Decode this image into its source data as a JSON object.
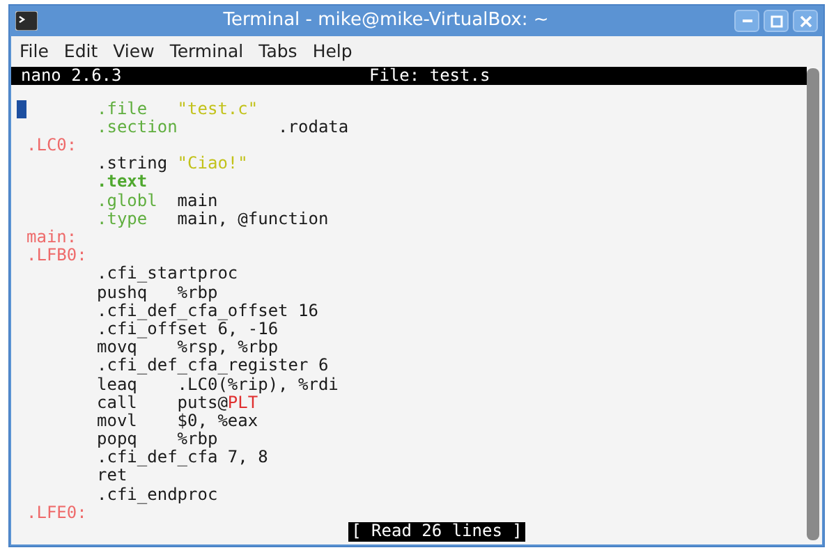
{
  "window": {
    "title": "Terminal - mike@mike-VirtualBox: ~"
  },
  "menu": [
    "File",
    "Edit",
    "View",
    "Terminal",
    "Tabs",
    "Help"
  ],
  "nano_header": {
    "version": "nano 2.6.3",
    "file": "File: test.s"
  },
  "lines": [
    {
      "cursor": true,
      "kind": "code",
      "segments": [
        {
          "kind": "directive",
          "text": ".file   "
        },
        {
          "kind": "string",
          "text": "\"test.c\""
        }
      ]
    },
    {
      "cursor": false,
      "kind": "code",
      "segments": [
        {
          "kind": "directive",
          "text": ".section"
        },
        {
          "kind": "plain",
          "text": "          .rodata"
        }
      ]
    },
    {
      "cursor": false,
      "kind": "label",
      "segments": [
        {
          "kind": "label",
          "text": ".LC0:"
        }
      ]
    },
    {
      "cursor": false,
      "kind": "code",
      "segments": [
        {
          "kind": "plain",
          "text": ".string "
        },
        {
          "kind": "string",
          "text": "\"Ciao!\""
        }
      ]
    },
    {
      "cursor": false,
      "kind": "code",
      "segments": [
        {
          "kind": "keyword",
          "text": ".text"
        }
      ]
    },
    {
      "cursor": false,
      "kind": "code",
      "segments": [
        {
          "kind": "directive",
          "text": ".globl"
        },
        {
          "kind": "plain",
          "text": "  main"
        }
      ]
    },
    {
      "cursor": false,
      "kind": "code",
      "segments": [
        {
          "kind": "directive",
          "text": ".type"
        },
        {
          "kind": "plain",
          "text": "   main, @function"
        }
      ]
    },
    {
      "cursor": false,
      "kind": "label",
      "segments": [
        {
          "kind": "label",
          "text": "main:"
        }
      ]
    },
    {
      "cursor": false,
      "kind": "label",
      "segments": [
        {
          "kind": "label",
          "text": ".LFB0:"
        }
      ]
    },
    {
      "cursor": false,
      "kind": "code",
      "segments": [
        {
          "kind": "plain",
          "text": ".cfi_startproc"
        }
      ]
    },
    {
      "cursor": false,
      "kind": "code",
      "segments": [
        {
          "kind": "plain",
          "text": "pushq   %rbp"
        }
      ]
    },
    {
      "cursor": false,
      "kind": "code",
      "segments": [
        {
          "kind": "plain",
          "text": ".cfi_def_cfa_offset 16"
        }
      ]
    },
    {
      "cursor": false,
      "kind": "code",
      "segments": [
        {
          "kind": "plain",
          "text": ".cfi_offset 6, -16"
        }
      ]
    },
    {
      "cursor": false,
      "kind": "code",
      "segments": [
        {
          "kind": "plain",
          "text": "movq    %rsp, %rbp"
        }
      ]
    },
    {
      "cursor": false,
      "kind": "code",
      "segments": [
        {
          "kind": "plain",
          "text": ".cfi_def_cfa_register 6"
        }
      ]
    },
    {
      "cursor": false,
      "kind": "code",
      "segments": [
        {
          "kind": "plain",
          "text": "leaq    .LC0(%rip), %rdi"
        }
      ]
    },
    {
      "cursor": false,
      "kind": "code",
      "segments": [
        {
          "kind": "plain",
          "text": "call    puts@"
        },
        {
          "kind": "error",
          "text": "PLT"
        }
      ]
    },
    {
      "cursor": false,
      "kind": "code",
      "segments": [
        {
          "kind": "plain",
          "text": "movl    $0, %eax"
        }
      ]
    },
    {
      "cursor": false,
      "kind": "code",
      "segments": [
        {
          "kind": "plain",
          "text": "popq    %rbp"
        }
      ]
    },
    {
      "cursor": false,
      "kind": "code",
      "segments": [
        {
          "kind": "plain",
          "text": ".cfi_def_cfa 7, 8"
        }
      ]
    },
    {
      "cursor": false,
      "kind": "code",
      "segments": [
        {
          "kind": "plain",
          "text": "ret"
        }
      ]
    },
    {
      "cursor": false,
      "kind": "code",
      "segments": [
        {
          "kind": "plain",
          "text": ".cfi_endproc"
        }
      ]
    },
    {
      "cursor": false,
      "kind": "label",
      "segments": [
        {
          "kind": "label",
          "text": ".LFE0:"
        }
      ]
    }
  ],
  "status": "[ Read 26 lines ]"
}
